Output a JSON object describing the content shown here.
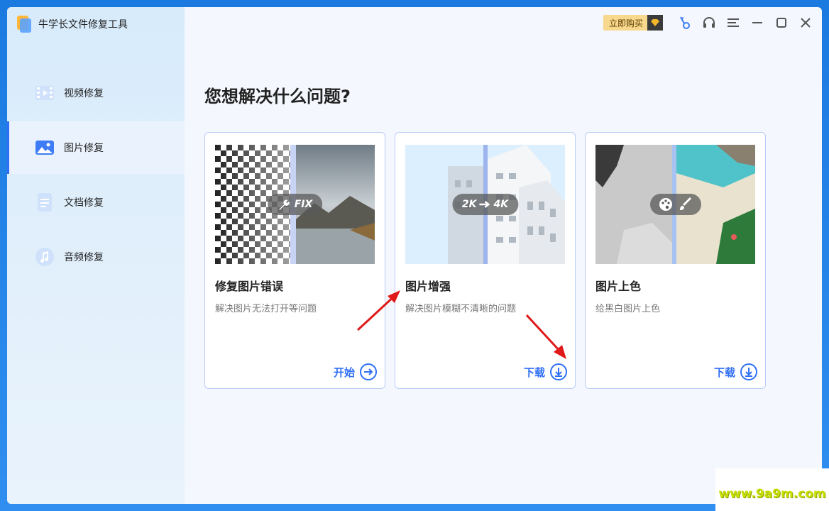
{
  "app": {
    "title": "牛学长文件修复工具"
  },
  "topbar": {
    "buy_label": "立即购买"
  },
  "sidebar": {
    "items": [
      {
        "label": "视频修复",
        "icon": "video-icon",
        "active": false
      },
      {
        "label": "图片修复",
        "icon": "image-icon",
        "active": true
      },
      {
        "label": "文档修复",
        "icon": "document-icon",
        "active": false
      },
      {
        "label": "音频修复",
        "icon": "music-note-icon",
        "active": false
      }
    ]
  },
  "main": {
    "heading": "您想解决什么问题?",
    "cards": [
      {
        "title": "修复图片错误",
        "desc": "解决图片无法打开等问题",
        "action": "开始",
        "badge": "FIX"
      },
      {
        "title": "图片增强",
        "desc": "解决图片模糊不清晰的问题",
        "action": "下载",
        "badge_from": "2K",
        "badge_to": "4K"
      },
      {
        "title": "图片上色",
        "desc": "给黑白图片上色",
        "action": "下载"
      }
    ]
  },
  "watermark": "www.9a9m.com",
  "colors": {
    "accent": "#2f6ff5",
    "card_border": "#b9ccf6",
    "buy_bg": "#f7d88c",
    "annotation_arrow": "#e01a1a"
  }
}
